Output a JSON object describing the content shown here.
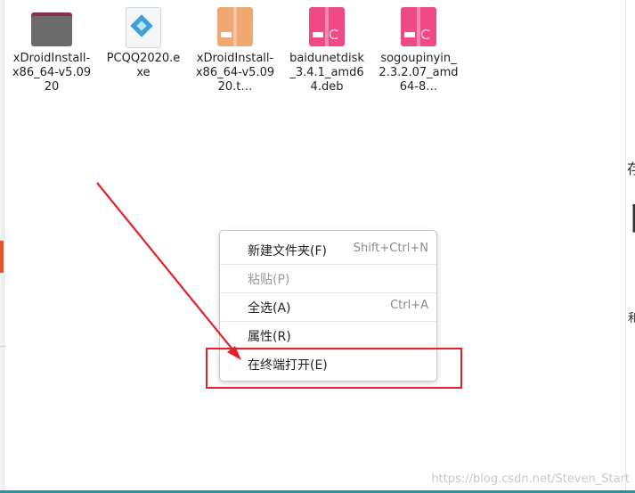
{
  "desktop": {
    "files": [
      {
        "name": "xDroidInstall-x86_64-v5.0920",
        "icon": "folder-icon",
        "kind": "folder"
      },
      {
        "name": "PCQQ2020.exe",
        "icon": "exe-icon",
        "kind": "exe"
      },
      {
        "name": "xDroidInstall-x86_64-v5.0920.t…",
        "icon": "archive-icon",
        "kind": "archive",
        "color": "#f0a872"
      },
      {
        "name": "baidunetdisk_3.4.1_amd64.deb",
        "icon": "deb-package-icon",
        "kind": "deb",
        "color": "#ef4a86"
      },
      {
        "name": "sogoupinyin_2.3.2.07_amd64-8…",
        "icon": "deb-package-icon",
        "kind": "deb",
        "color": "#ef4a86"
      }
    ]
  },
  "context_menu": {
    "items": [
      {
        "label": "新建文件夹(F)",
        "shortcut": "Shift+Ctrl+N",
        "enabled": true
      },
      {
        "label": "粘贴(P)",
        "shortcut": "",
        "enabled": false
      },
      {
        "label": "全选(A)",
        "shortcut": "Ctrl+A",
        "enabled": true
      },
      {
        "label": "属性(R)",
        "shortcut": "",
        "enabled": true
      },
      {
        "label": "在终端打开(E)",
        "shortcut": "",
        "enabled": true
      }
    ]
  },
  "right_edge_glyphs": [
    "存",
    "自",
    "和"
  ],
  "watermark": "https://blog.csdn.net/Steven_Start",
  "colors": {
    "accent": "#e95420",
    "annotation_red": "#e0232a",
    "archive_orange": "#f0a872",
    "deb_pink": "#ef4a86"
  }
}
